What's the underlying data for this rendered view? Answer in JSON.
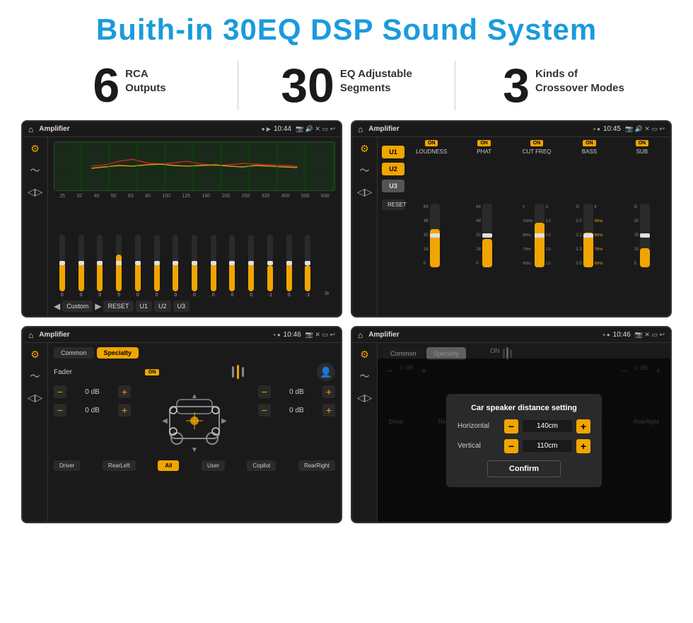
{
  "header": {
    "title": "Buith-in 30EQ DSP Sound System"
  },
  "stats": [
    {
      "number": "6",
      "label_line1": "RCA",
      "label_line2": "Outputs"
    },
    {
      "number": "30",
      "label_line1": "EQ Adjustable",
      "label_line2": "Segments"
    },
    {
      "number": "3",
      "label_line1": "Kinds of",
      "label_line2": "Crossover Modes"
    }
  ],
  "screens": {
    "top_left": {
      "title": "Amplifier",
      "time": "10:44",
      "eq_freqs": [
        "25",
        "32",
        "40",
        "50",
        "63",
        "80",
        "100",
        "125",
        "160",
        "200",
        "250",
        "320",
        "400",
        "500",
        "630"
      ],
      "eq_values": [
        "0",
        "0",
        "0",
        "5",
        "0",
        "0",
        "0",
        "0",
        "0",
        "0",
        "0",
        "-1",
        "0",
        "-1"
      ],
      "preset_label": "Custom",
      "buttons": [
        "RESET",
        "U1",
        "U2",
        "U3"
      ]
    },
    "top_right": {
      "title": "Amplifier",
      "time": "10:45",
      "channels": [
        "LOUDNESS",
        "PHAT",
        "CUT FREQ",
        "BASS",
        "SUB"
      ],
      "u_buttons": [
        "U1",
        "U2",
        "U3"
      ],
      "reset_label": "RESET"
    },
    "bottom_left": {
      "title": "Amplifier",
      "time": "10:46",
      "tabs": [
        "Common",
        "Specialty"
      ],
      "active_tab": "Specialty",
      "fader_label": "Fader",
      "fader_on": "ON",
      "volumes": [
        "0 dB",
        "0 dB",
        "0 dB",
        "0 dB"
      ],
      "buttons": [
        "Driver",
        "Copilot",
        "RearLeft",
        "All",
        "User",
        "RearRight"
      ]
    },
    "bottom_right": {
      "title": "Amplifier",
      "time": "10:46",
      "tabs": [
        "Common",
        "Specialty"
      ],
      "dialog": {
        "title": "Car speaker distance setting",
        "horizontal_label": "Horizontal",
        "horizontal_value": "140cm",
        "vertical_label": "Vertical",
        "vertical_value": "110cm",
        "confirm_label": "Confirm"
      }
    }
  }
}
